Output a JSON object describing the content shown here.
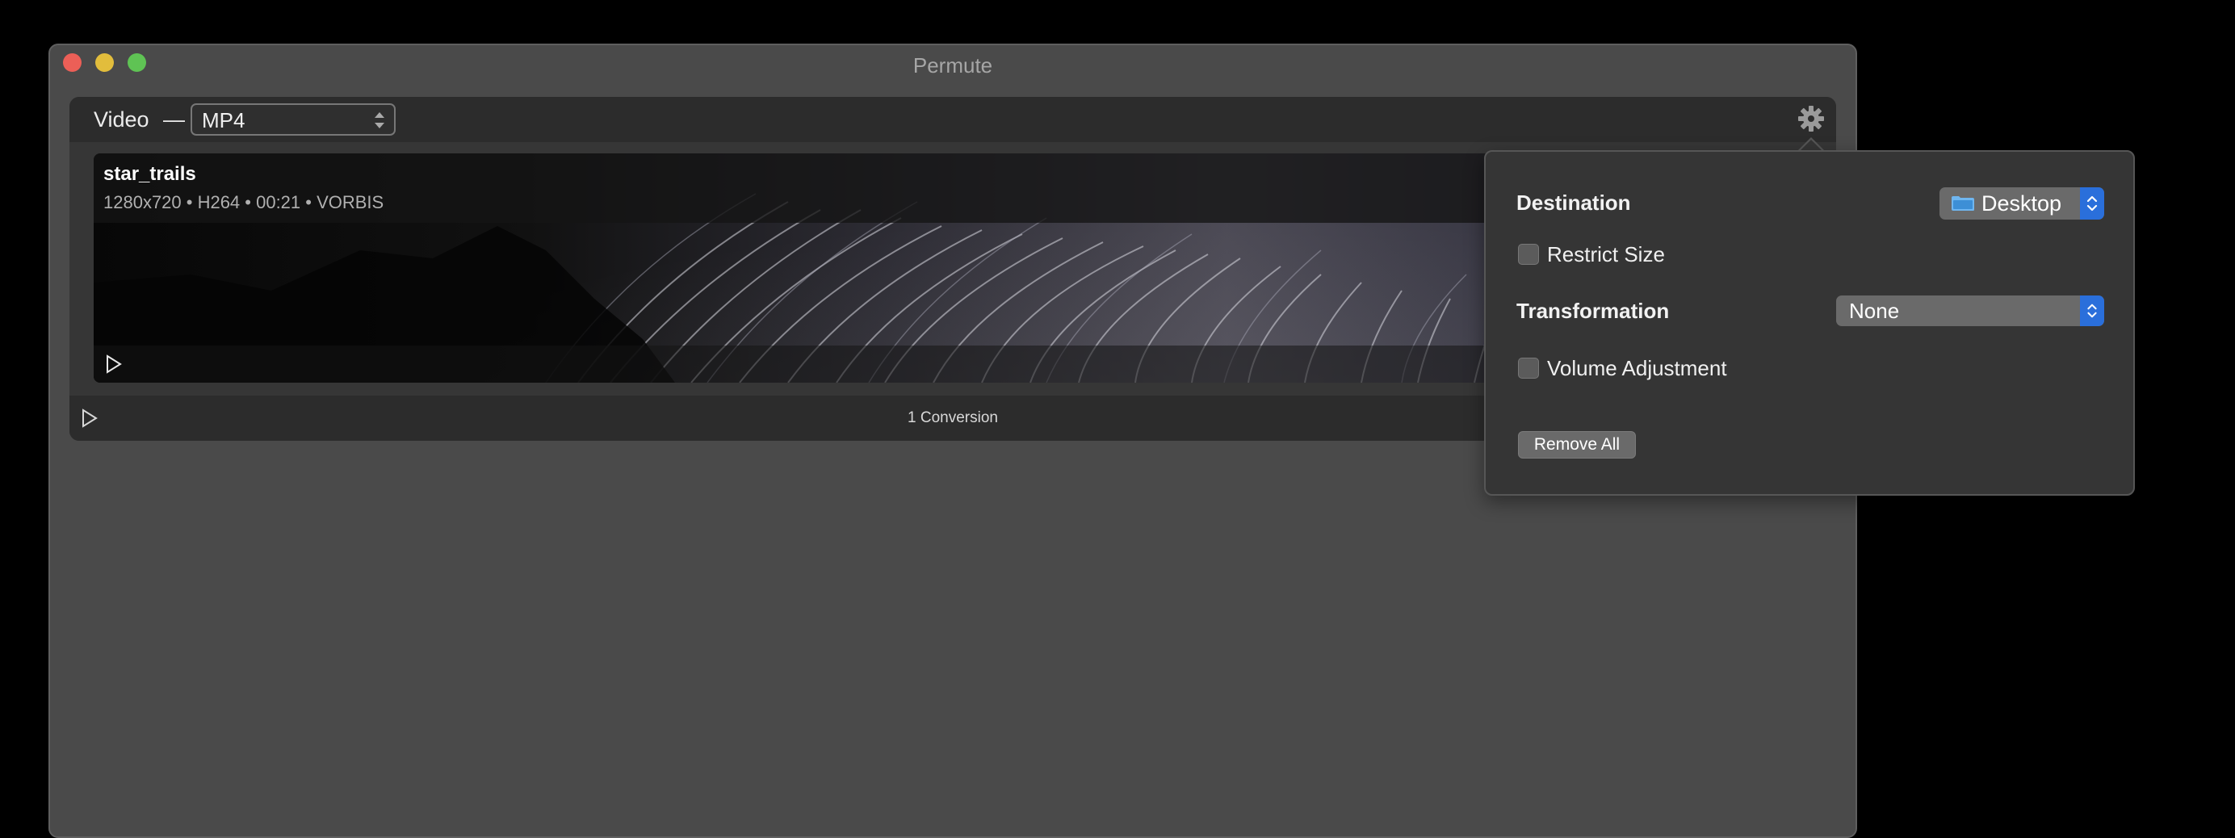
{
  "window": {
    "title": "Permute"
  },
  "toolbar": {
    "media_type": "Video",
    "separator": "—",
    "format": "MP4",
    "settings_icon": "gear-icon"
  },
  "item": {
    "file_name": "star_trails",
    "file_meta": "1280x720 • H264 • 00:21 • VORBIS",
    "play_icon": "play-icon"
  },
  "footer": {
    "conversion_count": "1 Conversion",
    "start_icon": "play-icon"
  },
  "popover": {
    "destination_label": "Destination",
    "destination_value": "Desktop",
    "restrict_size_label": "Restrict Size",
    "restrict_size_checked": false,
    "transformation_label": "Transformation",
    "transformation_value": "None",
    "volume_label": "Volume Adjustment",
    "volume_checked": false,
    "remove_all_label": "Remove All"
  },
  "colors": {
    "accent": "#2a6fdb",
    "close": "#ec5f57",
    "minimize": "#e2bd3c",
    "maximize": "#5fc354"
  }
}
